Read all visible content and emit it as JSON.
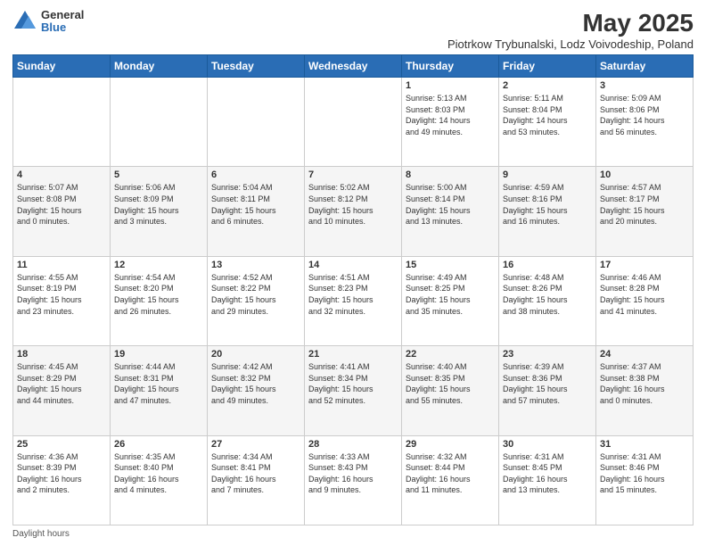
{
  "logo": {
    "general": "General",
    "blue": "Blue"
  },
  "header": {
    "title": "May 2025",
    "subtitle": "Piotrkow Trybunalski, Lodz Voivodeship, Poland"
  },
  "days_of_week": [
    "Sunday",
    "Monday",
    "Tuesday",
    "Wednesday",
    "Thursday",
    "Friday",
    "Saturday"
  ],
  "weeks": [
    [
      {
        "day": "",
        "info": ""
      },
      {
        "day": "",
        "info": ""
      },
      {
        "day": "",
        "info": ""
      },
      {
        "day": "",
        "info": ""
      },
      {
        "day": "1",
        "info": "Sunrise: 5:13 AM\nSunset: 8:03 PM\nDaylight: 14 hours\nand 49 minutes."
      },
      {
        "day": "2",
        "info": "Sunrise: 5:11 AM\nSunset: 8:04 PM\nDaylight: 14 hours\nand 53 minutes."
      },
      {
        "day": "3",
        "info": "Sunrise: 5:09 AM\nSunset: 8:06 PM\nDaylight: 14 hours\nand 56 minutes."
      }
    ],
    [
      {
        "day": "4",
        "info": "Sunrise: 5:07 AM\nSunset: 8:08 PM\nDaylight: 15 hours\nand 0 minutes."
      },
      {
        "day": "5",
        "info": "Sunrise: 5:06 AM\nSunset: 8:09 PM\nDaylight: 15 hours\nand 3 minutes."
      },
      {
        "day": "6",
        "info": "Sunrise: 5:04 AM\nSunset: 8:11 PM\nDaylight: 15 hours\nand 6 minutes."
      },
      {
        "day": "7",
        "info": "Sunrise: 5:02 AM\nSunset: 8:12 PM\nDaylight: 15 hours\nand 10 minutes."
      },
      {
        "day": "8",
        "info": "Sunrise: 5:00 AM\nSunset: 8:14 PM\nDaylight: 15 hours\nand 13 minutes."
      },
      {
        "day": "9",
        "info": "Sunrise: 4:59 AM\nSunset: 8:16 PM\nDaylight: 15 hours\nand 16 minutes."
      },
      {
        "day": "10",
        "info": "Sunrise: 4:57 AM\nSunset: 8:17 PM\nDaylight: 15 hours\nand 20 minutes."
      }
    ],
    [
      {
        "day": "11",
        "info": "Sunrise: 4:55 AM\nSunset: 8:19 PM\nDaylight: 15 hours\nand 23 minutes."
      },
      {
        "day": "12",
        "info": "Sunrise: 4:54 AM\nSunset: 8:20 PM\nDaylight: 15 hours\nand 26 minutes."
      },
      {
        "day": "13",
        "info": "Sunrise: 4:52 AM\nSunset: 8:22 PM\nDaylight: 15 hours\nand 29 minutes."
      },
      {
        "day": "14",
        "info": "Sunrise: 4:51 AM\nSunset: 8:23 PM\nDaylight: 15 hours\nand 32 minutes."
      },
      {
        "day": "15",
        "info": "Sunrise: 4:49 AM\nSunset: 8:25 PM\nDaylight: 15 hours\nand 35 minutes."
      },
      {
        "day": "16",
        "info": "Sunrise: 4:48 AM\nSunset: 8:26 PM\nDaylight: 15 hours\nand 38 minutes."
      },
      {
        "day": "17",
        "info": "Sunrise: 4:46 AM\nSunset: 8:28 PM\nDaylight: 15 hours\nand 41 minutes."
      }
    ],
    [
      {
        "day": "18",
        "info": "Sunrise: 4:45 AM\nSunset: 8:29 PM\nDaylight: 15 hours\nand 44 minutes."
      },
      {
        "day": "19",
        "info": "Sunrise: 4:44 AM\nSunset: 8:31 PM\nDaylight: 15 hours\nand 47 minutes."
      },
      {
        "day": "20",
        "info": "Sunrise: 4:42 AM\nSunset: 8:32 PM\nDaylight: 15 hours\nand 49 minutes."
      },
      {
        "day": "21",
        "info": "Sunrise: 4:41 AM\nSunset: 8:34 PM\nDaylight: 15 hours\nand 52 minutes."
      },
      {
        "day": "22",
        "info": "Sunrise: 4:40 AM\nSunset: 8:35 PM\nDaylight: 15 hours\nand 55 minutes."
      },
      {
        "day": "23",
        "info": "Sunrise: 4:39 AM\nSunset: 8:36 PM\nDaylight: 15 hours\nand 57 minutes."
      },
      {
        "day": "24",
        "info": "Sunrise: 4:37 AM\nSunset: 8:38 PM\nDaylight: 16 hours\nand 0 minutes."
      }
    ],
    [
      {
        "day": "25",
        "info": "Sunrise: 4:36 AM\nSunset: 8:39 PM\nDaylight: 16 hours\nand 2 minutes."
      },
      {
        "day": "26",
        "info": "Sunrise: 4:35 AM\nSunset: 8:40 PM\nDaylight: 16 hours\nand 4 minutes."
      },
      {
        "day": "27",
        "info": "Sunrise: 4:34 AM\nSunset: 8:41 PM\nDaylight: 16 hours\nand 7 minutes."
      },
      {
        "day": "28",
        "info": "Sunrise: 4:33 AM\nSunset: 8:43 PM\nDaylight: 16 hours\nand 9 minutes."
      },
      {
        "day": "29",
        "info": "Sunrise: 4:32 AM\nSunset: 8:44 PM\nDaylight: 16 hours\nand 11 minutes."
      },
      {
        "day": "30",
        "info": "Sunrise: 4:31 AM\nSunset: 8:45 PM\nDaylight: 16 hours\nand 13 minutes."
      },
      {
        "day": "31",
        "info": "Sunrise: 4:31 AM\nSunset: 8:46 PM\nDaylight: 16 hours\nand 15 minutes."
      }
    ]
  ],
  "footer": {
    "label": "Daylight hours"
  }
}
